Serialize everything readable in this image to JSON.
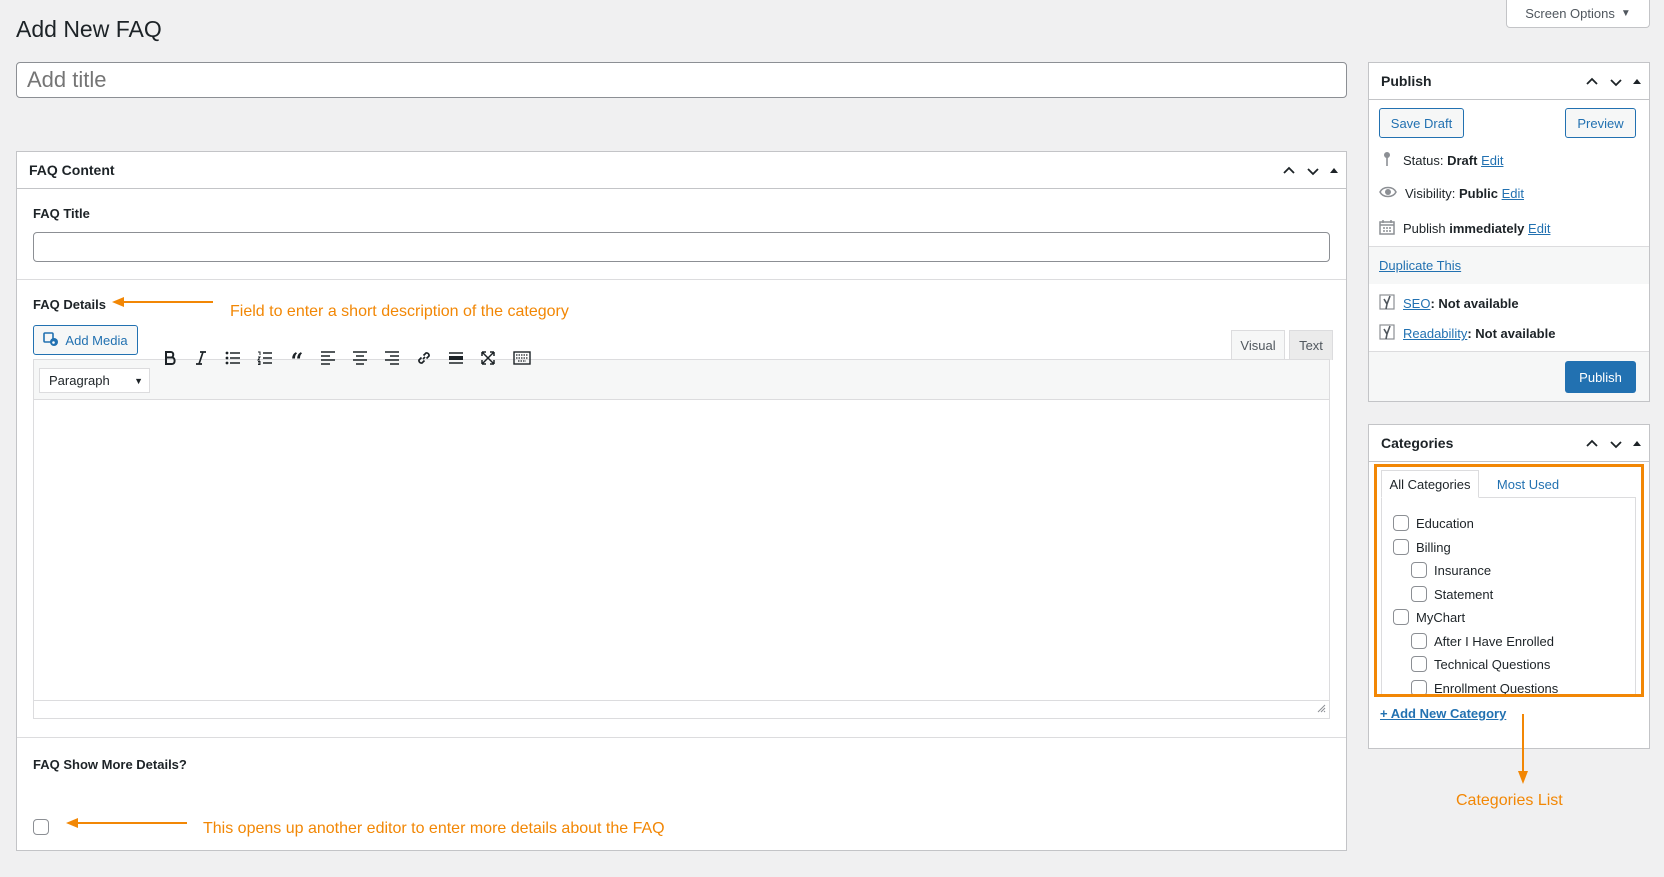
{
  "header": {
    "page_title": "Add New FAQ",
    "screen_options": "Screen Options",
    "title_placeholder": "Add title"
  },
  "faq_box": {
    "title": "FAQ Content",
    "faq_title_label": "FAQ Title",
    "faq_details_label": "FAQ Details",
    "add_media": "Add Media",
    "tab_visual": "Visual",
    "tab_text": "Text",
    "format_select": "Paragraph",
    "toolbar_icons": [
      "bold-icon",
      "italic-icon",
      "bullet-list-icon",
      "numbered-list-icon",
      "blockquote-icon",
      "align-left-icon",
      "align-center-icon",
      "align-right-icon",
      "link-icon",
      "read-more-icon",
      "fullscreen-icon",
      "toolbar-toggle-icon"
    ],
    "show_more_label": "FAQ Show More Details?"
  },
  "publish": {
    "title": "Publish",
    "save_draft": "Save Draft",
    "preview": "Preview",
    "status_label": "Status:",
    "status_value": "Draft",
    "visibility_label": "Visibility:",
    "visibility_value": "Public",
    "publish_label": "Publish",
    "publish_value": "immediately",
    "edit": "Edit",
    "duplicate": "Duplicate This",
    "seo_link": "SEO",
    "seo_value": ": Not available",
    "readability_link": "Readability",
    "readability_value": ": Not available",
    "publish_button": "Publish"
  },
  "categories": {
    "title": "Categories",
    "tab_all": "All Categories",
    "tab_most_used": "Most Used",
    "items": [
      {
        "label": "Education",
        "level": 0
      },
      {
        "label": "Billing",
        "level": 0
      },
      {
        "label": "Insurance",
        "level": 1
      },
      {
        "label": "Statement",
        "level": 1
      },
      {
        "label": "MyChart",
        "level": 0
      },
      {
        "label": "After I Have Enrolled",
        "level": 1
      },
      {
        "label": "Technical Questions",
        "level": 1
      },
      {
        "label": "Enrollment Questions",
        "level": 1
      }
    ],
    "add_new": "+ Add New Category"
  },
  "annotations": {
    "details": "Field to enter a short description of the category",
    "show_more": "This opens up another editor to enter more details about the FAQ",
    "categories": "Categories List"
  },
  "colors": {
    "accent": "#2271b1",
    "annotation": "#f28705",
    "publish_button": "#2271b1"
  }
}
